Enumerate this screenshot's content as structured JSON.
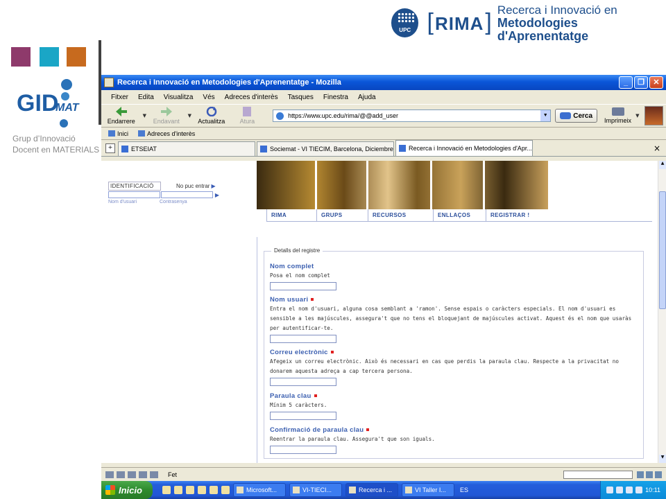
{
  "slide": {
    "gid_caption_line1": "Grup d’Innovació",
    "gid_caption_line2": "Docent en MATERIALS",
    "rima_title": "RIMA",
    "rima_sub1": "Recerca i Innovació en",
    "rima_sub2": "Metodologies d'Aprenentatge",
    "upc_label": "UPC",
    "square_colors": [
      "#8e3a6b",
      "#1aa6c6",
      "#c76a1e"
    ]
  },
  "window": {
    "title": "Recerca i Innovació en Metodologies d'Aprenentatge - Mozilla",
    "menu": [
      "Fitxer",
      "Edita",
      "Visualitza",
      "Vés",
      "Adreces d'interès",
      "Tasques",
      "Finestra",
      "Ajuda"
    ],
    "toolbar": {
      "back": "Endarrere",
      "forward": "Endavant",
      "reload": "Actualitza",
      "stop": "Atura",
      "url": "https://www.upc.edu/rima/@@add_user",
      "search": "Cerca",
      "print": "Imprimeix"
    },
    "bookmarks": [
      "Inici",
      "Adreces d'interès"
    ],
    "tabs": [
      {
        "label": "ETSEIAT"
      },
      {
        "label": "Sociemat - VI TIECIM, Barcelona, Diciembre ..."
      },
      {
        "label": "Recerca i Innovació en Metodologies d'Apr..."
      }
    ],
    "tab_close": "×",
    "status_text": "Fet"
  },
  "page": {
    "login": {
      "id_label": "IDENTIFICACIÓ",
      "cannot_enter": "No puc entrar",
      "username_label": "Nom d'usuari",
      "password_label": "Contrasenya"
    },
    "nav": [
      "RIMA",
      "GRUPS",
      "RECURSOS",
      "ENLLAÇOS",
      "REGISTRAR !"
    ],
    "form_legend": "Detalls del registre",
    "fields": [
      {
        "label": "Nom complet",
        "help": [
          "Posa el nom complet"
        ],
        "required": false
      },
      {
        "label": "Nom usuari",
        "help": [
          "Entra el nom d'usuari, alguna cosa semblant a 'ramon'. Sense espais o caràcters especials. El nom d'usuari es",
          "sensible a les majúscules, assegura't que no tens el bloquejant de majúscules activat. Aquest és el nom que usaràs",
          "per autentificar-te."
        ],
        "required": true
      },
      {
        "label": "Correu electrònic",
        "help": [
          "Afegeix un correu electrònic. Això és necessari en cas que perdis la paraula clau. Respecte a la privacitat no",
          "donarem aquesta adreça a cap tercera persona."
        ],
        "required": true
      },
      {
        "label": "Paraula clau",
        "help": [
          "Mínim 5 caràcters."
        ],
        "required": true
      },
      {
        "label": "Confirmació de paraula clau",
        "help": [
          "Reentrar la paraula clau. Assegura't que son iguals."
        ],
        "required": true
      }
    ]
  },
  "taskbar": {
    "start": "Inicio",
    "tasks": [
      "Microsoft...",
      "VI-TIECI...",
      "Recerca i ...",
      "VI Taller I..."
    ],
    "lang": "ES",
    "clock": "10:11"
  }
}
